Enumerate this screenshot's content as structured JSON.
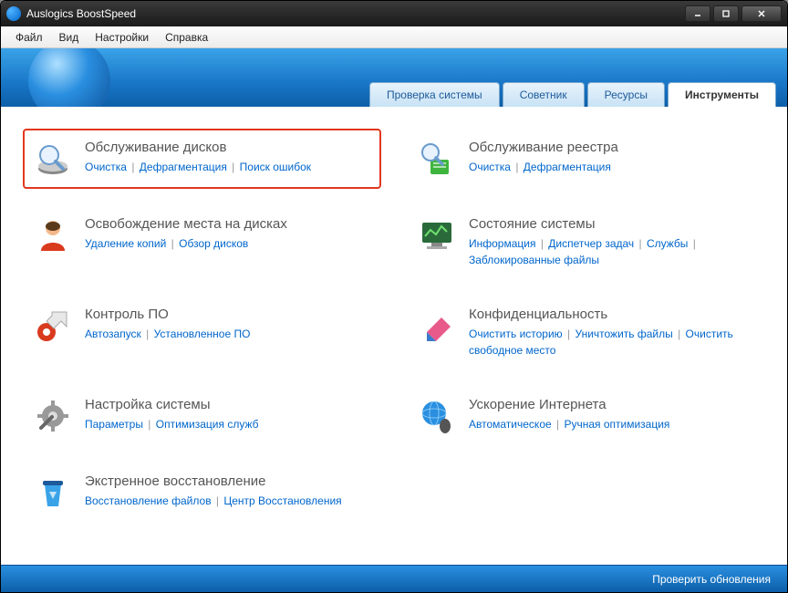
{
  "window": {
    "title": "Auslogics BoostSpeed"
  },
  "menu": {
    "file": "Файл",
    "view": "Вид",
    "settings": "Настройки",
    "help": "Справка"
  },
  "tabs": {
    "system_check": "Проверка системы",
    "advisor": "Советник",
    "resources": "Ресурсы",
    "tools": "Инструменты"
  },
  "tools": {
    "disk_maint": {
      "title": "Обслуживание дисков",
      "links": [
        "Очистка",
        "Дефрагментация",
        "Поиск ошибок"
      ]
    },
    "registry_maint": {
      "title": "Обслуживание реестра",
      "links": [
        "Очистка",
        "Дефрагментация"
      ]
    },
    "free_space": {
      "title": "Освобождение места на дисках",
      "links": [
        "Удаление копий",
        "Обзор дисков"
      ]
    },
    "system_state": {
      "title": "Состояние системы",
      "links": [
        "Информация",
        "Диспетчер задач",
        "Службы",
        "Заблокированные файлы"
      ]
    },
    "software_control": {
      "title": "Контроль ПО",
      "links": [
        "Автозапуск",
        "Установленное ПО"
      ]
    },
    "privacy": {
      "title": "Конфиденциальность",
      "links": [
        "Очистить историю",
        "Уничтожить файлы",
        "Очистить свободное место"
      ]
    },
    "system_tweak": {
      "title": "Настройка системы",
      "links": [
        "Параметры",
        "Оптимизация служб"
      ]
    },
    "internet_boost": {
      "title": "Ускорение Интернета",
      "links": [
        "Автоматическое",
        "Ручная оптимизация"
      ]
    },
    "emergency_recovery": {
      "title": "Экстренное восстановление",
      "links": [
        "Восстановление файлов",
        "Центр Восстановления"
      ]
    }
  },
  "status": {
    "check_updates": "Проверить обновления"
  },
  "colors": {
    "accent": "#0d5fa8",
    "link": "#0066cc",
    "highlight": "#e2371e"
  }
}
